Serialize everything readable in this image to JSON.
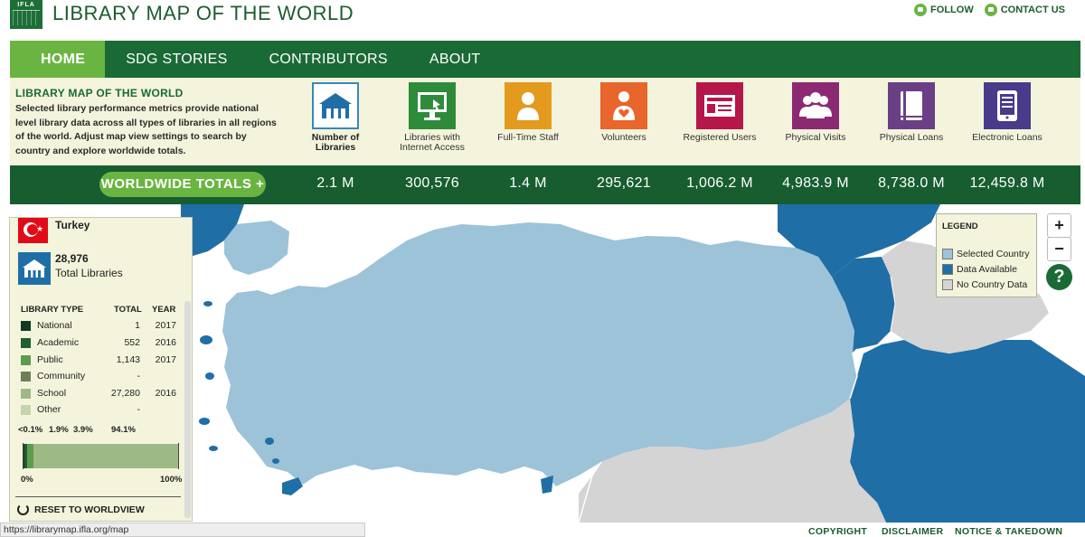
{
  "header": {
    "logo_text": "IFLA",
    "site_title": "LIBRARY MAP OF THE WORLD",
    "links": [
      {
        "label": "FOLLOW",
        "icon": "twitter-icon"
      },
      {
        "label": "CONTACT US",
        "icon": "mail-icon"
      }
    ]
  },
  "nav": {
    "items": [
      "HOME",
      "SDG STORIES",
      "CONTRIBUTORS",
      "ABOUT"
    ],
    "active": "HOME"
  },
  "info": {
    "title": "LIBRARY MAP OF THE WORLD",
    "description": "Selected library performance metrics provide national level library data across all types of libraries in all regions of the world. Adjust map view settings to search by country and explore worldwide totals."
  },
  "metrics": [
    {
      "label": "Number of Libraries",
      "icon": "library-building-icon",
      "color": "#ffffff",
      "total": "2.1 M"
    },
    {
      "label": "Libraries with Internet Access",
      "icon": "computer-monitor-icon",
      "color": "#2e8b3a",
      "total": "300,576"
    },
    {
      "label": "Full-Time Staff",
      "icon": "person-icon",
      "color": "#e39b1e",
      "total": "1.4 M"
    },
    {
      "label": "Volunteers",
      "icon": "volunteer-heart-icon",
      "color": "#e8652c",
      "total": "295,621"
    },
    {
      "label": "Registered Users",
      "icon": "id-card-icon",
      "color": "#b5174a",
      "total": "1,006.2 M"
    },
    {
      "label": "Physical Visits",
      "icon": "group-people-icon",
      "color": "#8b2a73",
      "total": "4,983.9 M"
    },
    {
      "label": "Physical Loans",
      "icon": "book-icon",
      "color": "#6a3f86",
      "total": "8,738.0 M"
    },
    {
      "label": "Electronic Loans",
      "icon": "tablet-icon",
      "color": "#4a3a8a",
      "total": "12,459.8 M"
    }
  ],
  "totals": {
    "button_label": "WORLDWIDE TOTALS +"
  },
  "legend": {
    "title": "LEGEND",
    "items": [
      {
        "label": "Selected Country",
        "color": "#9dc3d9"
      },
      {
        "label": "Data Available",
        "color": "#1f6fa6"
      },
      {
        "label": "No Country Data",
        "color": "#d4d4d4"
      }
    ]
  },
  "map_controls": {
    "zoom_in": "+",
    "zoom_out": "−",
    "help": "?"
  },
  "panel": {
    "country": "Turkey",
    "total_libraries": "28,976",
    "total_label": "Total Libraries",
    "columns": [
      "LIBRARY TYPE",
      "TOTAL",
      "YEAR"
    ],
    "rows": [
      {
        "type": "National",
        "total": "1",
        "year": "2017",
        "color": "#0f3a1e"
      },
      {
        "type": "Academic",
        "total": "552",
        "year": "2016",
        "color": "#1f5e2f"
      },
      {
        "type": "Public",
        "total": "1,143",
        "year": "2017",
        "color": "#5e9c4d"
      },
      {
        "type": "Community",
        "total": "-",
        "year": "",
        "color": "#6e7f55"
      },
      {
        "type": "School",
        "total": "27,280",
        "year": "2016",
        "color": "#9dba86"
      },
      {
        "type": "Other",
        "total": "-",
        "year": "",
        "color": "#c5d4ae"
      }
    ],
    "percentages": [
      "<0.1%",
      "1.9%",
      "3.9%",
      "94.1%"
    ],
    "bar_shares": [
      0.1,
      1.9,
      3.9,
      94.1
    ],
    "axis_start": "0%",
    "axis_end": "100%",
    "reset_label": "RESET TO WORLDVIEW"
  },
  "footer": {
    "url": "https://librarymap.ifla.org/map",
    "links": [
      "COPYRIGHT",
      "DISCLAIMER",
      "NOTICE & TAKEDOWN"
    ]
  }
}
